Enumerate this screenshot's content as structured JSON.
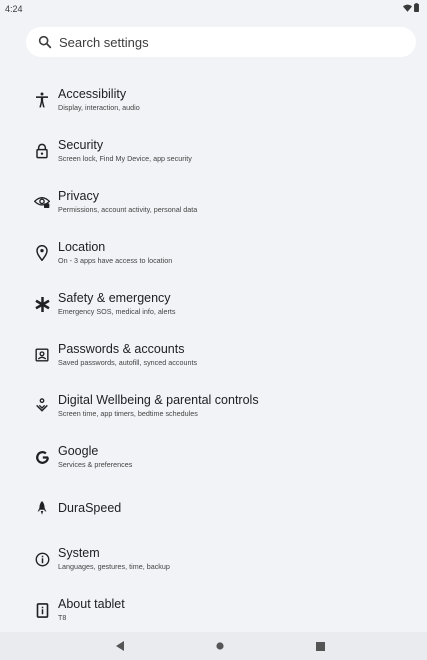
{
  "status_bar": {
    "time": "4:24",
    "wifi_icon": "wifi-icon",
    "battery_icon": "battery-icon"
  },
  "search": {
    "placeholder": "Search settings"
  },
  "settings": [
    {
      "id": "accessibility",
      "icon": "accessibility-icon",
      "title": "Accessibility",
      "subtitle": "Display, interaction, audio"
    },
    {
      "id": "security",
      "icon": "lock-icon",
      "title": "Security",
      "subtitle": "Screen lock, Find My Device, app security"
    },
    {
      "id": "privacy",
      "icon": "privacy-eye-icon",
      "title": "Privacy",
      "subtitle": "Permissions, account activity, personal data"
    },
    {
      "id": "location",
      "icon": "location-pin-icon",
      "title": "Location",
      "subtitle": "On - 3 apps have access to location"
    },
    {
      "id": "safety",
      "icon": "asterisk-icon",
      "title": "Safety & emergency",
      "subtitle": "Emergency SOS, medical info, alerts"
    },
    {
      "id": "passwords",
      "icon": "account-box-icon",
      "title": "Passwords & accounts",
      "subtitle": "Saved passwords, autofill, synced accounts"
    },
    {
      "id": "wellbeing",
      "icon": "wellbeing-icon",
      "title": "Digital Wellbeing & parental controls",
      "subtitle": "Screen time, app timers, bedtime schedules"
    },
    {
      "id": "google",
      "icon": "google-g-icon",
      "title": "Google",
      "subtitle": "Services & preferences"
    },
    {
      "id": "duraspeed",
      "icon": "rocket-icon",
      "title": "DuraSpeed",
      "subtitle": ""
    },
    {
      "id": "system",
      "icon": "info-icon",
      "title": "System",
      "subtitle": "Languages, gestures, time, backup"
    },
    {
      "id": "about",
      "icon": "tablet-icon",
      "title": "About tablet",
      "subtitle": "T8"
    }
  ],
  "nav_bar": {
    "back_icon": "back-triangle-icon",
    "home_icon": "home-dot-icon",
    "recents_icon": "recents-square-icon"
  }
}
